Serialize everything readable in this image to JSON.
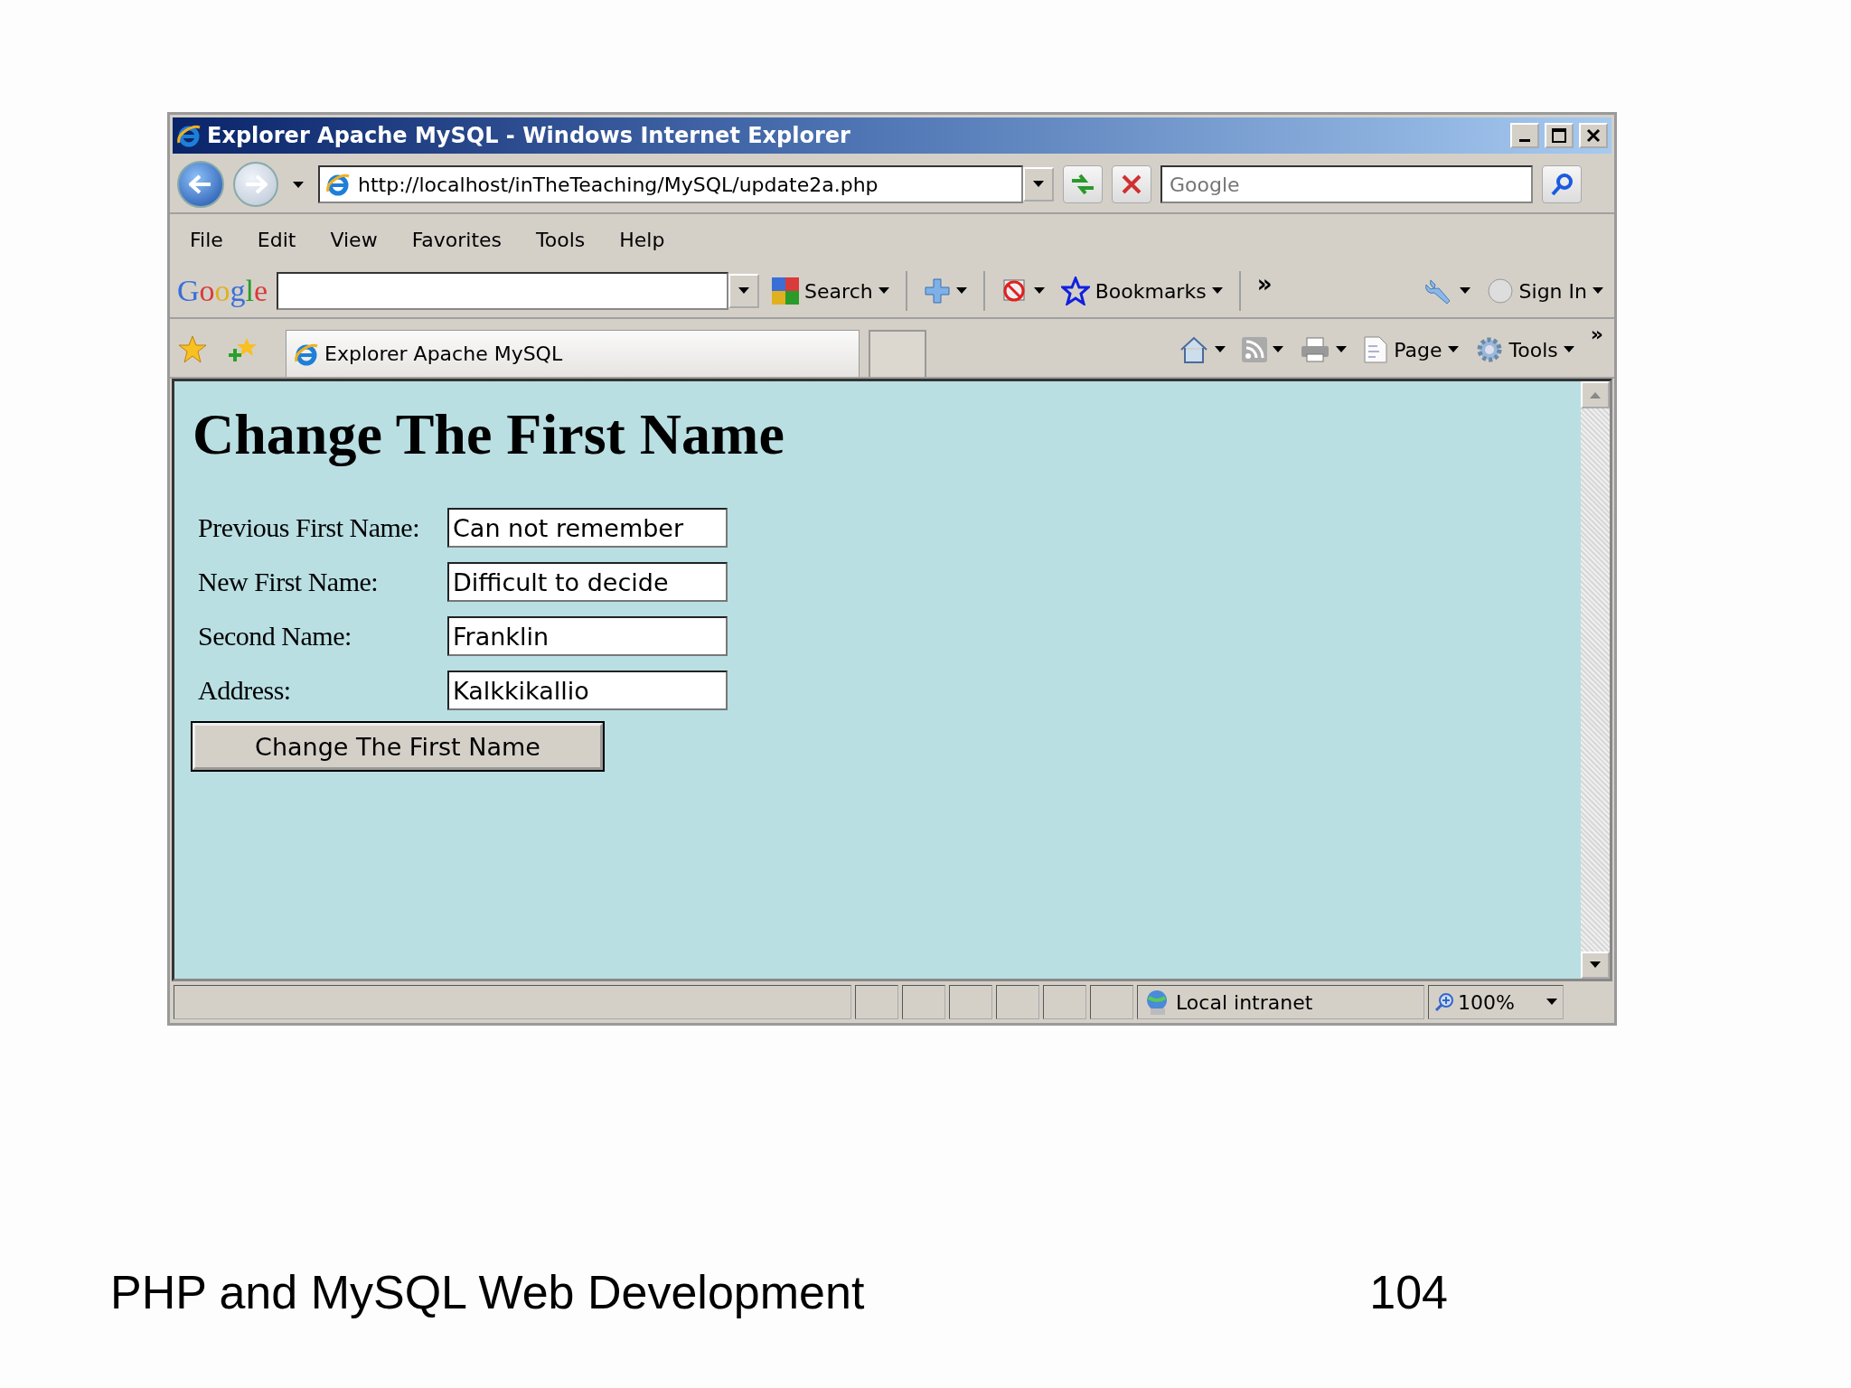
{
  "window": {
    "title": "Explorer Apache MySQL - Windows Internet Explorer"
  },
  "address_bar": {
    "url": "http://localhost/inTheTeaching/MySQL/update2a.php",
    "search_placeholder": "Google"
  },
  "menu": [
    "File",
    "Edit",
    "View",
    "Favorites",
    "Tools",
    "Help"
  ],
  "google_toolbar": {
    "logo": "Google",
    "search_label": "Search",
    "bookmarks_label": "Bookmarks",
    "sign_in_label": "Sign In",
    "more": "»"
  },
  "tab": {
    "title": "Explorer Apache MySQL",
    "selected": true
  },
  "command_bar": {
    "page_label": "Page",
    "tools_label": "Tools",
    "more": "»"
  },
  "page": {
    "heading": "Change The First Name",
    "fields": [
      {
        "label": "Previous First Name:",
        "value": "Can not remember"
      },
      {
        "label": "New First Name:",
        "value": "Difficult to decide"
      },
      {
        "label": "Second Name:",
        "value": "Franklin"
      },
      {
        "label": "Address:",
        "value": "Kalkkikallio"
      }
    ],
    "submit": "Change The First Name"
  },
  "status_bar": {
    "zone": "Local intranet",
    "zoom": "100%"
  },
  "slide": {
    "footer": "PHP and MySQL Web Development",
    "page_number": "104"
  }
}
